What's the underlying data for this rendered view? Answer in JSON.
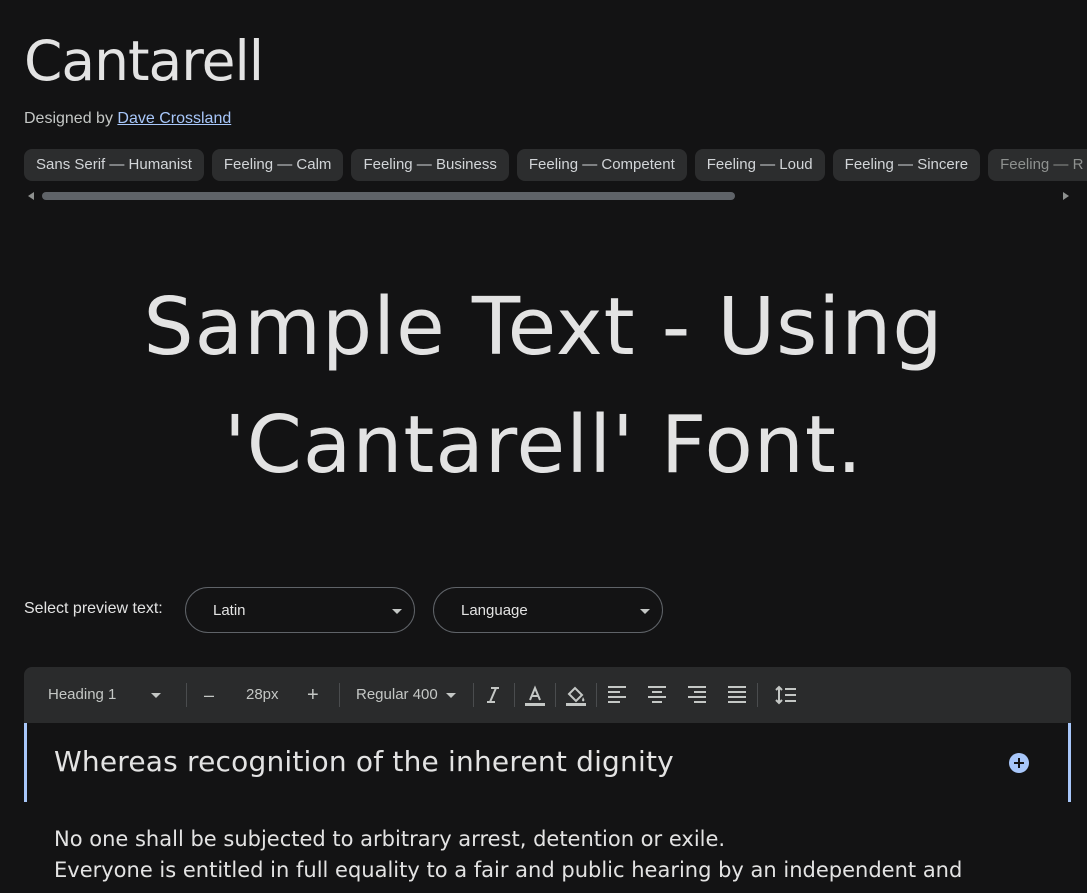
{
  "font": {
    "name": "Cantarell",
    "designed_by_label": "Designed by",
    "designer": "Dave Crossland"
  },
  "tags": [
    "Sans Serif — Humanist",
    "Feeling — Calm",
    "Feeling — Business",
    "Feeling — Competent",
    "Feeling — Loud",
    "Feeling — Sincere",
    "Feeling — R"
  ],
  "sample": {
    "line1": "Sample Text - Using",
    "line2": "'Cantarell' Font."
  },
  "preview": {
    "label": "Select preview text:",
    "script_select": "Latin",
    "language_select": "Language"
  },
  "toolbar": {
    "style_select": "Heading 1",
    "decrease": "–",
    "size": "28px",
    "increase": "+",
    "weight_select": "Regular 400",
    "icons": [
      "italic-icon",
      "text-color-icon",
      "highlight-icon",
      "align-left-icon",
      "align-center-icon",
      "align-right-icon",
      "align-justify-icon",
      "line-spacing-icon"
    ]
  },
  "editor": {
    "heading": "Whereas recognition of the inherent dignity",
    "paragraph_line1": "No one shall be subjected to arbitrary arrest, detention or exile.",
    "paragraph_line2": "Everyone is entitled in full equality to a fair and public hearing by an independent and"
  },
  "colors": {
    "background": "#131314",
    "accent": "#a8c7fa",
    "chip": "#2c2d2e",
    "toolbar": "#2a2b2c"
  }
}
